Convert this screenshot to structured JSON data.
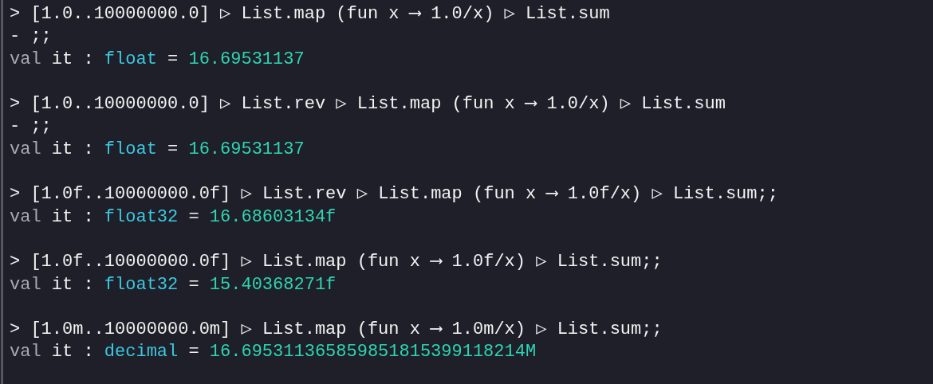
{
  "entries": [
    {
      "input_lines": [
        "> [1.0..10000000.0] ▷ List.map (fun x ⟶ 1.0/x) ▷ List.sum",
        "- ;;"
      ],
      "result": {
        "keyword": "val",
        "name": "it",
        "colon": ":",
        "type": "float",
        "equals": "=",
        "value": "16.69531137"
      }
    },
    {
      "input_lines": [
        "> [1.0..10000000.0] ▷ List.rev ▷ List.map (fun x ⟶ 1.0/x) ▷ List.sum",
        "- ;;"
      ],
      "result": {
        "keyword": "val",
        "name": "it",
        "colon": ":",
        "type": "float",
        "equals": "=",
        "value": "16.69531137"
      }
    },
    {
      "input_lines": [
        "> [1.0f..10000000.0f] ▷ List.rev ▷ List.map (fun x ⟶ 1.0f/x) ▷ List.sum;;"
      ],
      "result": {
        "keyword": "val",
        "name": "it",
        "colon": ":",
        "type": "float32",
        "equals": "=",
        "value": "16.68603134f"
      }
    },
    {
      "input_lines": [
        "> [1.0f..10000000.0f] ▷ List.map (fun x ⟶ 1.0f/x) ▷ List.sum;;"
      ],
      "result": {
        "keyword": "val",
        "name": "it",
        "colon": ":",
        "type": "float32",
        "equals": "=",
        "value": "15.40368271f"
      }
    },
    {
      "input_lines": [
        "> [1.0m..10000000.0m] ▷ List.map (fun x ⟶ 1.0m/x) ▷ List.sum;;"
      ],
      "result": {
        "keyword": "val",
        "name": "it",
        "colon": ":",
        "type": "decimal",
        "equals": "=",
        "value": "16.695311365859851815399118214M"
      }
    }
  ]
}
